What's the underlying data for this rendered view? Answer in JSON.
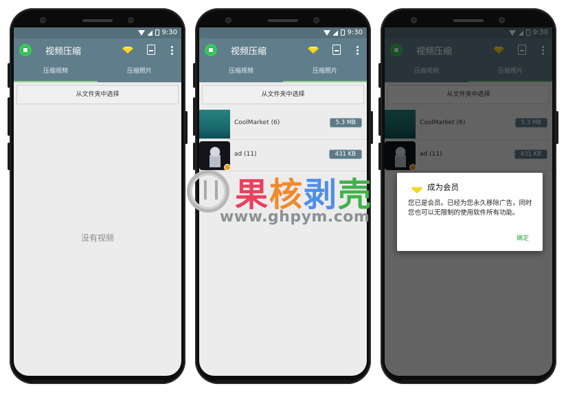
{
  "status_bar": {
    "time": "9:30"
  },
  "app": {
    "title": "视频压缩",
    "tabs": [
      "压缩视频",
      "压缩照片"
    ],
    "select_folder_label": "从文件夹中选择",
    "empty_video_text": "没有视频"
  },
  "photo_folders": [
    {
      "name": "CoolMarket (6)",
      "size": "5.3 MB",
      "thumb": "teal-gradient"
    },
    {
      "name": "ad (11)",
      "size": "431 KB",
      "thumb": "dark-portrait"
    }
  ],
  "dialog": {
    "title": "成为会员",
    "message": "您已是会员。已经为您永久移除广告，同时您也可以无限制的使用软件所有功能。",
    "ok_label": "确定"
  },
  "watermark": {
    "chars": [
      "果",
      "核",
      "剥",
      "壳"
    ],
    "char_colors": [
      "#e8415f",
      "#f08a2a",
      "#4f8fe6",
      "#3fb24a"
    ],
    "url": "www.ghpym.com"
  },
  "colors": {
    "toolbar": "#607d8b",
    "status_bar": "#56707b",
    "accent_green": "#2ca94a",
    "gem_yellow": "#f6d418",
    "size_badge": "#5e7a86"
  },
  "icons": [
    "app-logo-icon",
    "diamond-icon",
    "compress-doc-icon",
    "more-vert-icon",
    "wifi-icon",
    "signal-icon",
    "battery-icon"
  ]
}
